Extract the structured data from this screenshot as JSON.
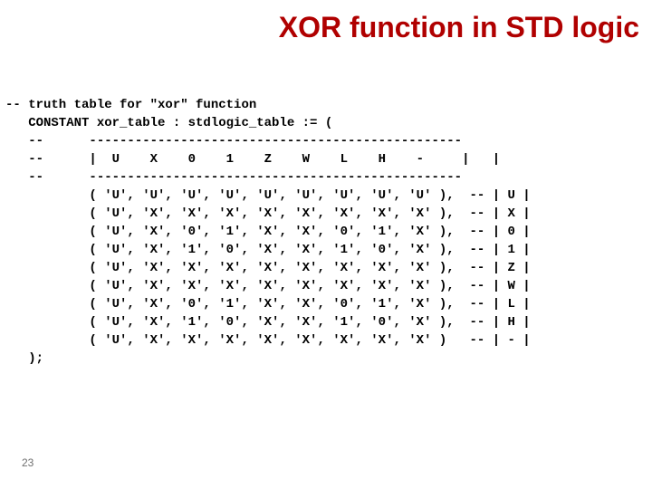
{
  "title": "XOR function in STD logic",
  "page_number": "23",
  "code": "-- truth table for \"xor\" function\n   CONSTANT xor_table : stdlogic_table := (\n   --      -------------------------------------------------\n   --      |  U    X    0    1    Z    W    L    H    -     |   |\n   --      -------------------------------------------------\n           ( 'U', 'U', 'U', 'U', 'U', 'U', 'U', 'U', 'U' ),  -- | U |\n           ( 'U', 'X', 'X', 'X', 'X', 'X', 'X', 'X', 'X' ),  -- | X |\n           ( 'U', 'X', '0', '1', 'X', 'X', '0', '1', 'X' ),  -- | 0 |\n           ( 'U', 'X', '1', '0', 'X', 'X', '1', '0', 'X' ),  -- | 1 |\n           ( 'U', 'X', 'X', 'X', 'X', 'X', 'X', 'X', 'X' ),  -- | Z |\n           ( 'U', 'X', 'X', 'X', 'X', 'X', 'X', 'X', 'X' ),  -- | W |\n           ( 'U', 'X', '0', '1', 'X', 'X', '0', '1', 'X' ),  -- | L |\n           ( 'U', 'X', '1', '0', 'X', 'X', '1', '0', 'X' ),  -- | H |\n           ( 'U', 'X', 'X', 'X', 'X', 'X', 'X', 'X', 'X' )   -- | - |\n   );"
}
